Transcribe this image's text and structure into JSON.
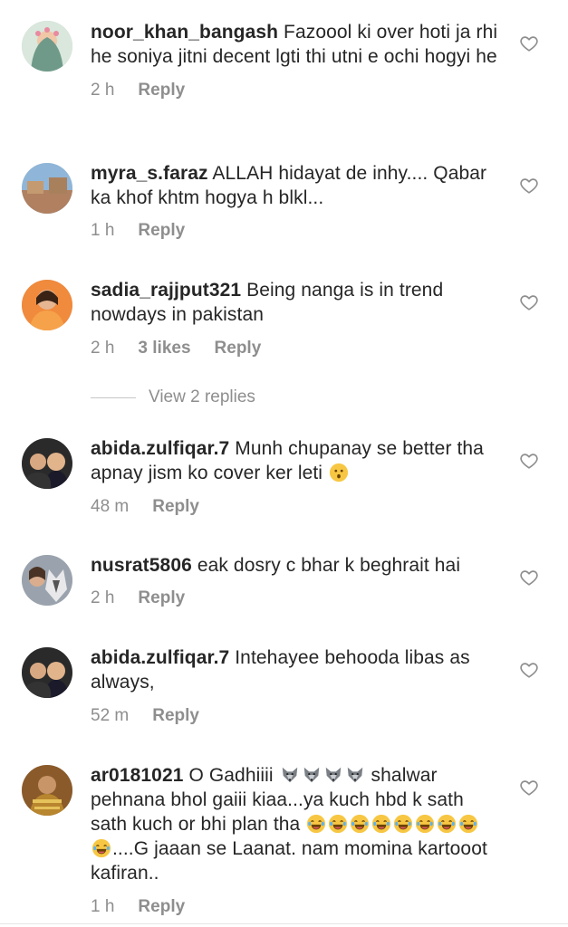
{
  "comments": [
    {
      "username": "noor_khan_bangash",
      "text": "Fazoool ki over hoti ja rhi he soniya jitni decent lgti thi utni e ochi hogyi he",
      "time": "2 h",
      "reply_label": "Reply"
    },
    {
      "username": "myra_s.faraz",
      "text": "ALLAH hidayat de inhy.... Qabar ka khof khtm hogya h blkl...",
      "time": "1 h",
      "reply_label": "Reply"
    },
    {
      "username": "sadia_rajjput321",
      "text": "Being nanga is in trend nowdays in pakistan",
      "time": "2 h",
      "likes": "3 likes",
      "reply_label": "Reply"
    },
    {
      "username": "abida.zulfiqar.7",
      "text": "Munh chupanay se better tha apnay jism ko cover ker leti",
      "time": "48 m",
      "reply_label": "Reply"
    },
    {
      "username": "nusrat5806",
      "text": "eak dosry c bhar k beghrait hai",
      "time": "2 h",
      "reply_label": "Reply"
    },
    {
      "username": "abida.zulfiqar.7",
      "text": "Intehayee behooda libas as always,",
      "time": "52 m",
      "reply_label": "Reply"
    },
    {
      "username": "ar0181021",
      "text_a": "O Gadhiiii",
      "text_b": "shalwar pehnana bhol gaiii kiaa...ya kuch hbd k sath sath kuch or bhi plan tha",
      "text_c": "....G jaaan se Laanat. nam momina kartooot kafiran..",
      "time": "1 h",
      "reply_label": "Reply"
    }
  ],
  "view_replies": "View 2 replies",
  "icons": {
    "like": "heart-outline-icon",
    "emoji_surprised": "hushed-face-emoji",
    "emoji_wolf": "wolf-face-emoji",
    "emoji_laugh": "tears-of-joy-emoji"
  },
  "colors": {
    "text": "#262626",
    "secondary": "#8e8e8e"
  }
}
